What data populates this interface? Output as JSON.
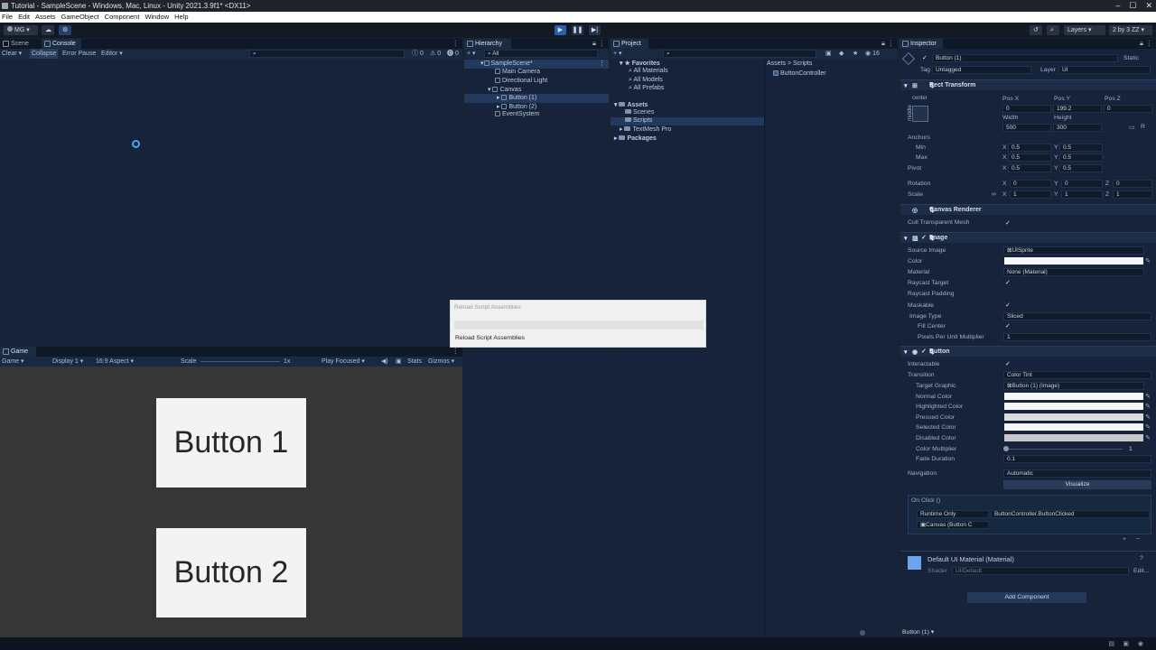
{
  "window": {
    "title": "Tutorial - SampleScene - Windows, Mac, Linux - Unity 2021.3.9f1* <DX11>",
    "controls": [
      "–",
      "☐",
      "✕"
    ]
  },
  "menu": [
    "File",
    "Edit",
    "Assets",
    "GameObject",
    "Component",
    "Window",
    "Help"
  ],
  "toolbar": {
    "account": "MG ▾",
    "layers": "Layers",
    "layout": "2 by 3 ZZ"
  },
  "console": {
    "tabs": [
      "Scene",
      "Console"
    ],
    "buttons": [
      "Clear ▾",
      "Collapse",
      "Error Pause",
      "Editor ▾"
    ],
    "counts": [
      "0",
      "0",
      "0"
    ]
  },
  "game": {
    "tab": "Game",
    "display": "Game",
    "display_num": "Display 1",
    "aspect": "16:9 Aspect",
    "scale_label": "Scale",
    "scale_value": "1x",
    "play_focused": "Play Focused",
    "stats": "Stats",
    "gizmos": "Gizmos",
    "button1": "Button 1",
    "button2": "Button 2"
  },
  "hierarchy": {
    "tab": "Hierarchy",
    "search": "All",
    "scene": "SampleScene*",
    "items": [
      "Main Camera",
      "Directional Light",
      "Canvas",
      "Button (1)",
      "Button (2)",
      "EventSystem"
    ]
  },
  "project": {
    "tab": "Project",
    "favorites": "Favorites",
    "fav_items": [
      "All Materials",
      "All Models",
      "All Prefabs"
    ],
    "assets": "Assets",
    "asset_items": [
      "Scenes",
      "Scripts",
      "TextMesh Pro"
    ],
    "packages": "Packages",
    "breadcrumb": "Assets > Scripts",
    "file": "ButtonController",
    "count": "16"
  },
  "dialog": {
    "title": "Reload Script Assemblies",
    "message": "Reload Script Assemblies"
  },
  "inspector": {
    "tab": "Inspector",
    "object_name": "Button (1)",
    "static": "Static",
    "tag_label": "Tag",
    "tag": "Untagged",
    "layer_label": "Layer",
    "layer": "UI",
    "rect_transform": {
      "title": "Rect Transform",
      "center": "center",
      "middle": "middle",
      "pos_x_label": "Pos X",
      "pos_x": "0",
      "pos_y_label": "Pos Y",
      "pos_y": "199.2",
      "pos_z_label": "Pos Z",
      "pos_z": "0",
      "width_label": "Width",
      "width": "500",
      "height_label": "Height",
      "height": "300",
      "anchors": "Anchors",
      "min": "Min",
      "max": "Max",
      "pivot": "Pivot",
      "rotation": "Rotation",
      "scale": "Scale",
      "x": "X",
      "y": "Y",
      "z": "Z",
      "v05": "0.5",
      "v0": "0",
      "v1": "1"
    },
    "canvas_renderer": {
      "title": "Canvas Renderer",
      "cull": "Cull Transparent Mesh"
    },
    "image": {
      "title": "Image",
      "source_image_label": "Source Image",
      "source_image": "UISprite",
      "color_label": "Color",
      "material_label": "Material",
      "material": "None (Material)",
      "raycast_target": "Raycast Target",
      "raycast_padding": "Raycast Padding",
      "maskable": "Maskable",
      "image_type_label": "Image Type",
      "image_type": "Sliced",
      "fill_center": "Fill Center",
      "ppu_label": "Pixels Per Unit Multiplier",
      "ppu": "1"
    },
    "button": {
      "title": "Button",
      "interactable": "Interactable",
      "transition_label": "Transition",
      "transition": "Color Tint",
      "target_graphic_label": "Target Graphic",
      "target_graphic": "Button (1) (Image)",
      "normal": "Normal Color",
      "highlighted": "Highlighted Color",
      "pressed": "Pressed Color",
      "selected": "Selected Color",
      "disabled": "Disabled Color",
      "color_mult_label": "Color Multiplier",
      "color_mult": "1",
      "fade_label": "Fade Duration",
      "fade": "0.1",
      "navigation_label": "Navigation",
      "navigation": "Automatic",
      "visualize": "Visualize",
      "onclick": "On Click ()",
      "runtime": "Runtime Only",
      "function": "ButtonController.ButtonClicked",
      "object": "Canvas (Button C",
      "plus": "+",
      "minus": "−"
    },
    "material": {
      "title": "Default UI Material (Material)",
      "shader_label": "Shader",
      "shader": "UI/Default",
      "edit": "Edit..."
    },
    "add_component": "Add Component",
    "footer": "Button (1) ▾"
  },
  "colors": {
    "accent": "#3a79d8",
    "panel": "#16233a",
    "bg": "#1a2230"
  }
}
